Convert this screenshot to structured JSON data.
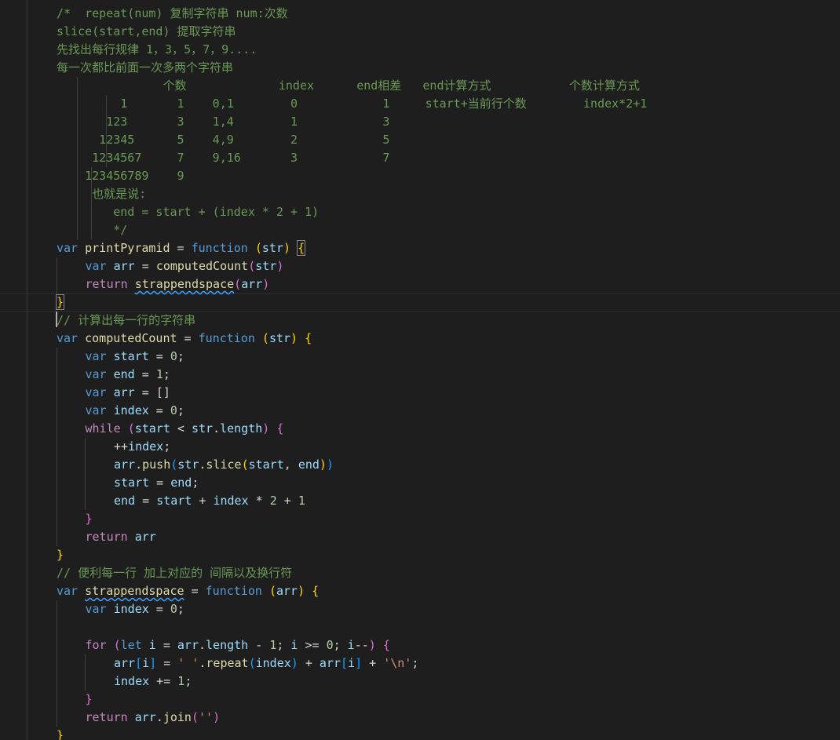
{
  "lines": [
    {
      "i": 0,
      "t": 6,
      "p": [
        [
          "cm",
          "/*  repeat(num) 复制字符串 num:次数"
        ]
      ]
    },
    {
      "i": 0,
      "t": 29,
      "p": [
        [
          "cm",
          "slice(start,end) 提取字符串"
        ]
      ]
    },
    {
      "i": 0,
      "t": 52,
      "p": [
        [
          "cm",
          "先找出每行规律 1，3，5，7，9...."
        ]
      ]
    },
    {
      "i": 0,
      "t": 75,
      "p": [
        [
          "cm",
          "每一次都比前面一次多两个字符串"
        ]
      ]
    },
    {
      "i": 0,
      "t": 98,
      "p": [
        [
          "cm",
          "               个数             index      end相差   end计算方式           个数计算方式"
        ]
      ]
    },
    {
      "i": 0,
      "t": 121,
      "p": [
        [
          "cm",
          "         1       1    0,1        0            1     start+当前行个数        index*2+1"
        ]
      ]
    },
    {
      "i": 0,
      "t": 144,
      "p": [
        [
          "cm",
          "       123       3    1,4        1            3"
        ]
      ]
    },
    {
      "i": 0,
      "t": 167,
      "p": [
        [
          "cm",
          "      12345      5    4,9        2            5"
        ]
      ]
    },
    {
      "i": 0,
      "t": 190,
      "p": [
        [
          "cm",
          "     1234567     7    9,16       3            7"
        ]
      ]
    },
    {
      "i": 0,
      "t": 213,
      "p": [
        [
          "cm",
          "    123456789    9"
        ]
      ]
    },
    {
      "i": 0,
      "t": 236,
      "p": [
        [
          "cm",
          "     也就是说:"
        ]
      ]
    },
    {
      "i": 0,
      "t": 259,
      "p": [
        [
          "cm",
          "        end = start + (index * 2 + 1)"
        ]
      ]
    },
    {
      "i": 0,
      "t": 282,
      "p": [
        [
          "cm",
          "        */"
        ]
      ]
    },
    {
      "i": 0,
      "t": 305,
      "p": [
        [
          "kw",
          "var "
        ],
        [
          "fn",
          "printPyramid"
        ],
        [
          "op",
          " = "
        ],
        [
          "kw",
          "function "
        ],
        [
          "b1",
          "("
        ],
        [
          "vr",
          "str"
        ],
        [
          "b1",
          ")"
        ],
        [
          "op",
          " "
        ],
        [
          "b1 bm",
          "{"
        ]
      ]
    },
    {
      "i": 1,
      "t": 328,
      "p": [
        [
          "kw",
          "var "
        ],
        [
          "vr",
          "arr"
        ],
        [
          "op",
          " = "
        ],
        [
          "fn",
          "computedCount"
        ],
        [
          "b2",
          "("
        ],
        [
          "vr",
          "str"
        ],
        [
          "b2",
          ")"
        ]
      ]
    },
    {
      "i": 1,
      "t": 351,
      "p": [
        [
          "ctl",
          "return "
        ],
        [
          "fn sq",
          "strappendspace"
        ],
        [
          "b2",
          "("
        ],
        [
          "vr",
          "arr"
        ],
        [
          "b2",
          ")"
        ]
      ]
    },
    {
      "i": 0,
      "t": 374,
      "p": [
        [
          "b1 bm",
          "}"
        ]
      ]
    },
    {
      "i": 0,
      "t": 397,
      "p": [
        [
          "cm",
          "// 计算出每一行的字符串"
        ]
      ]
    },
    {
      "i": 0,
      "t": 420,
      "p": [
        [
          "kw",
          "var "
        ],
        [
          "fn",
          "computedCount"
        ],
        [
          "op",
          " = "
        ],
        [
          "kw",
          "function "
        ],
        [
          "b1",
          "("
        ],
        [
          "vr",
          "str"
        ],
        [
          "b1",
          ")"
        ],
        [
          "op",
          " "
        ],
        [
          "b1",
          "{"
        ]
      ]
    },
    {
      "i": 1,
      "t": 443,
      "p": [
        [
          "kw",
          "var "
        ],
        [
          "vr",
          "start"
        ],
        [
          "op",
          " = "
        ],
        [
          "nm",
          "0"
        ],
        [
          "op",
          ";"
        ]
      ]
    },
    {
      "i": 1,
      "t": 466,
      "p": [
        [
          "kw",
          "var "
        ],
        [
          "vr",
          "end"
        ],
        [
          "op",
          " = "
        ],
        [
          "nm",
          "1"
        ],
        [
          "op",
          ";"
        ]
      ]
    },
    {
      "i": 1,
      "t": 489,
      "p": [
        [
          "kw",
          "var "
        ],
        [
          "vr",
          "arr"
        ],
        [
          "op",
          " = "
        ],
        [
          "op",
          "[]"
        ]
      ]
    },
    {
      "i": 1,
      "t": 512,
      "p": [
        [
          "kw",
          "var "
        ],
        [
          "vr",
          "index"
        ],
        [
          "op",
          " = "
        ],
        [
          "nm",
          "0"
        ],
        [
          "op",
          ";"
        ]
      ]
    },
    {
      "i": 1,
      "t": 535,
      "p": [
        [
          "ctl",
          "while "
        ],
        [
          "b2",
          "("
        ],
        [
          "vr",
          "start"
        ],
        [
          "op",
          " < "
        ],
        [
          "vr",
          "str"
        ],
        [
          "op",
          "."
        ],
        [
          "vr",
          "length"
        ],
        [
          "b2",
          ")"
        ],
        [
          "op",
          " "
        ],
        [
          "b2",
          "{"
        ]
      ]
    },
    {
      "i": 2,
      "t": 558,
      "p": [
        [
          "op",
          "++"
        ],
        [
          "vr",
          "index"
        ],
        [
          "op",
          ";"
        ]
      ]
    },
    {
      "i": 2,
      "t": 581,
      "p": [
        [
          "vr",
          "arr"
        ],
        [
          "op",
          "."
        ],
        [
          "fn",
          "push"
        ],
        [
          "b3",
          "("
        ],
        [
          "vr",
          "str"
        ],
        [
          "op",
          "."
        ],
        [
          "fn",
          "slice"
        ],
        [
          "b1",
          "("
        ],
        [
          "vr",
          "start"
        ],
        [
          "op",
          ", "
        ],
        [
          "vr",
          "end"
        ],
        [
          "b1",
          ")"
        ],
        [
          "b3",
          ")"
        ]
      ]
    },
    {
      "i": 2,
      "t": 604,
      "p": [
        [
          "vr",
          "start"
        ],
        [
          "op",
          " = "
        ],
        [
          "vr",
          "end"
        ],
        [
          "op",
          ";"
        ]
      ]
    },
    {
      "i": 2,
      "t": 627,
      "p": [
        [
          "vr",
          "end"
        ],
        [
          "op",
          " = "
        ],
        [
          "vr",
          "start"
        ],
        [
          "op",
          " + "
        ],
        [
          "vr",
          "index"
        ],
        [
          "op",
          " * "
        ],
        [
          "nm",
          "2"
        ],
        [
          "op",
          " + "
        ],
        [
          "nm",
          "1"
        ]
      ]
    },
    {
      "i": 1,
      "t": 650,
      "p": [
        [
          "b2",
          "}"
        ]
      ]
    },
    {
      "i": 1,
      "t": 673,
      "p": [
        [
          "ctl",
          "return "
        ],
        [
          "vr",
          "arr"
        ]
      ]
    },
    {
      "i": 0,
      "t": 696,
      "p": [
        [
          "b1",
          "}"
        ]
      ]
    },
    {
      "i": 0,
      "t": 719,
      "p": [
        [
          "cm",
          "// 便利每一行 加上对应的 间隔以及换行符"
        ]
      ]
    },
    {
      "i": 0,
      "t": 742,
      "p": [
        [
          "kw",
          "var "
        ],
        [
          "fn sq",
          "strappendspace"
        ],
        [
          "op",
          " = "
        ],
        [
          "kw",
          "function "
        ],
        [
          "b1",
          "("
        ],
        [
          "vr",
          "arr"
        ],
        [
          "b1",
          ")"
        ],
        [
          "op",
          " "
        ],
        [
          "b1",
          "{"
        ]
      ]
    },
    {
      "i": 1,
      "t": 765,
      "p": [
        [
          "kw",
          "var "
        ],
        [
          "vr",
          "index"
        ],
        [
          "op",
          " = "
        ],
        [
          "nm",
          "0"
        ],
        [
          "op",
          ";"
        ]
      ]
    },
    {
      "i": 1,
      "t": 811,
      "p": [
        [
          "ctl",
          "for "
        ],
        [
          "b2",
          "("
        ],
        [
          "kw",
          "let "
        ],
        [
          "vr",
          "i"
        ],
        [
          "op",
          " = "
        ],
        [
          "vr",
          "arr"
        ],
        [
          "op",
          "."
        ],
        [
          "vr",
          "length"
        ],
        [
          "op",
          " - "
        ],
        [
          "nm",
          "1"
        ],
        [
          "op",
          "; "
        ],
        [
          "vr",
          "i"
        ],
        [
          "op",
          " >= "
        ],
        [
          "nm",
          "0"
        ],
        [
          "op",
          "; "
        ],
        [
          "vr",
          "i"
        ],
        [
          "op",
          "--"
        ],
        [
          "b2",
          ")"
        ],
        [
          "op",
          " "
        ],
        [
          "b2",
          "{"
        ]
      ]
    },
    {
      "i": 2,
      "t": 834,
      "p": [
        [
          "vr",
          "arr"
        ],
        [
          "b3",
          "["
        ],
        [
          "vr",
          "i"
        ],
        [
          "b3",
          "]"
        ],
        [
          "op",
          " = "
        ],
        [
          "st",
          "' '"
        ],
        [
          "op",
          "."
        ],
        [
          "fn",
          "repeat"
        ],
        [
          "b3",
          "("
        ],
        [
          "vr",
          "index"
        ],
        [
          "b3",
          ")"
        ],
        [
          "op",
          " + "
        ],
        [
          "vr",
          "arr"
        ],
        [
          "b3",
          "["
        ],
        [
          "vr",
          "i"
        ],
        [
          "b3",
          "]"
        ],
        [
          "op",
          " + "
        ],
        [
          "st",
          "'\\n'"
        ],
        [
          "op",
          ";"
        ]
      ]
    },
    {
      "i": 2,
      "t": 857,
      "p": [
        [
          "vr",
          "index"
        ],
        [
          "op",
          " += "
        ],
        [
          "nm",
          "1"
        ],
        [
          "op",
          ";"
        ]
      ]
    },
    {
      "i": 1,
      "t": 880,
      "p": [
        [
          "b2",
          "}"
        ]
      ]
    },
    {
      "i": 1,
      "t": 903,
      "p": [
        [
          "ctl",
          "return "
        ],
        [
          "vr",
          "arr"
        ],
        [
          "op",
          "."
        ],
        [
          "fn",
          "join"
        ],
        [
          "b2",
          "("
        ],
        [
          "st",
          "''"
        ],
        [
          "b2",
          ")"
        ]
      ]
    },
    {
      "i": 0,
      "t": 926,
      "p": [
        [
          "b1",
          "}"
        ]
      ]
    }
  ]
}
